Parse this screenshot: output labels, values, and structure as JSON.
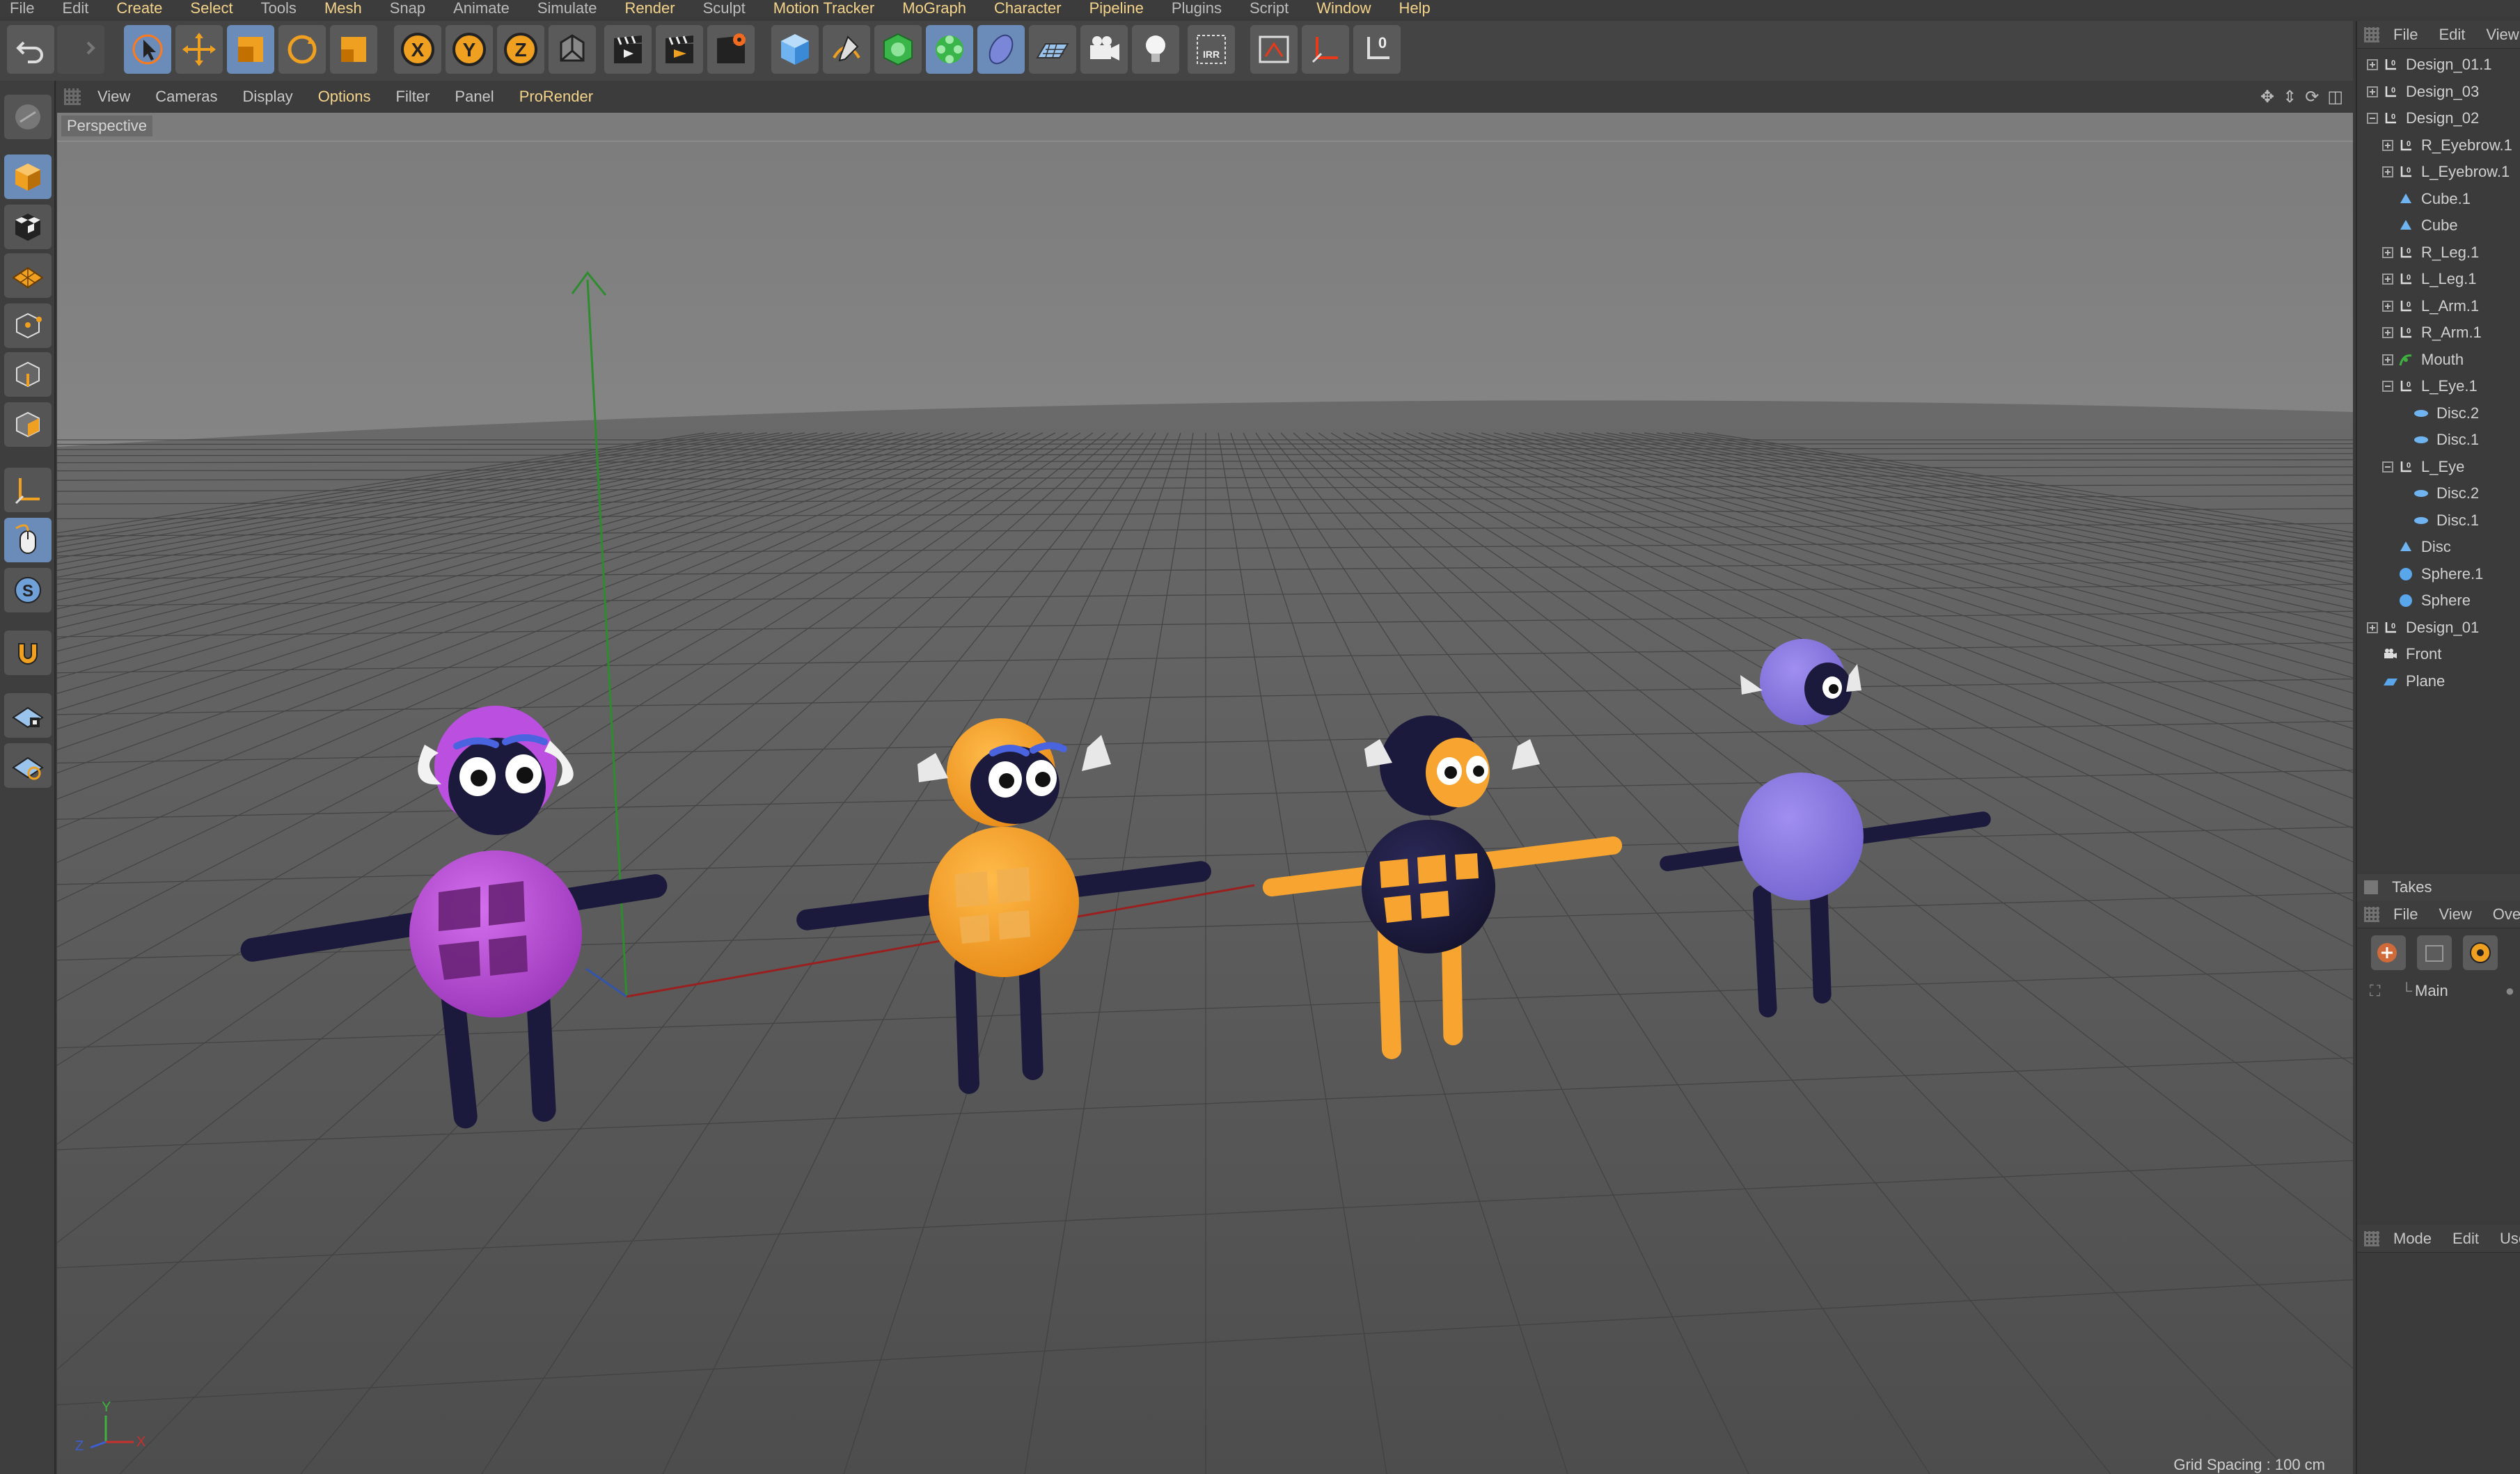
{
  "menubar": {
    "items": [
      {
        "label": "File",
        "highlight": false
      },
      {
        "label": "Edit",
        "highlight": false
      },
      {
        "label": "Create",
        "highlight": true
      },
      {
        "label": "Select",
        "highlight": true
      },
      {
        "label": "Tools",
        "highlight": false
      },
      {
        "label": "Mesh",
        "highlight": true
      },
      {
        "label": "Snap",
        "highlight": false
      },
      {
        "label": "Animate",
        "highlight": false
      },
      {
        "label": "Simulate",
        "highlight": false
      },
      {
        "label": "Render",
        "highlight": true
      },
      {
        "label": "Sculpt",
        "highlight": false
      },
      {
        "label": "Motion Tracker",
        "highlight": true
      },
      {
        "label": "MoGraph",
        "highlight": true
      },
      {
        "label": "Character",
        "highlight": true
      },
      {
        "label": "Pipeline",
        "highlight": true
      },
      {
        "label": "Plugins",
        "highlight": false
      },
      {
        "label": "Script",
        "highlight": false
      },
      {
        "label": "Window",
        "highlight": true
      },
      {
        "label": "Help",
        "highlight": true
      }
    ]
  },
  "toolbar": {
    "axis_x": "X",
    "axis_y": "Y",
    "axis_z": "Z",
    "irr_label": "IRR",
    "coord_label": "0"
  },
  "viewport": {
    "menu": [
      {
        "label": "View",
        "highlight": false
      },
      {
        "label": "Cameras",
        "highlight": false
      },
      {
        "label": "Display",
        "highlight": false
      },
      {
        "label": "Options",
        "highlight": true
      },
      {
        "label": "Filter",
        "highlight": false
      },
      {
        "label": "Panel",
        "highlight": false
      },
      {
        "label": "ProRender",
        "highlight": true
      }
    ],
    "camera_label": "Perspective",
    "grid_spacing": "Grid Spacing : 100 cm",
    "axis_labels": {
      "y": "Y",
      "z": "Z",
      "x": "X"
    }
  },
  "objects_panel": {
    "menu": [
      "File",
      "Edit",
      "View"
    ],
    "items": [
      {
        "name": "Design_01.1",
        "icon": "null-icon",
        "level": 0,
        "expander": "plus"
      },
      {
        "name": "Design_03",
        "icon": "null-icon",
        "level": 0,
        "expander": "plus"
      },
      {
        "name": "Design_02",
        "icon": "null-icon",
        "level": 0,
        "expander": "minus"
      },
      {
        "name": "R_Eyebrow.1",
        "icon": "null-icon",
        "level": 1,
        "expander": "plus"
      },
      {
        "name": "L_Eyebrow.1",
        "icon": "null-icon",
        "level": 1,
        "expander": "plus"
      },
      {
        "name": "Cube.1",
        "icon": "polygon-icon",
        "level": 1,
        "expander": "none"
      },
      {
        "name": "Cube",
        "icon": "polygon-icon",
        "level": 1,
        "expander": "none"
      },
      {
        "name": "R_Leg.1",
        "icon": "null-icon",
        "level": 1,
        "expander": "plus"
      },
      {
        "name": "L_Leg.1",
        "icon": "null-icon",
        "level": 1,
        "expander": "plus"
      },
      {
        "name": "L_Arm.1",
        "icon": "null-icon",
        "level": 1,
        "expander": "plus"
      },
      {
        "name": "R_Arm.1",
        "icon": "null-icon",
        "level": 1,
        "expander": "plus"
      },
      {
        "name": "Mouth",
        "icon": "spline-icon",
        "level": 1,
        "expander": "plus"
      },
      {
        "name": "L_Eye.1",
        "icon": "null-icon",
        "level": 1,
        "expander": "minus"
      },
      {
        "name": "Disc.2",
        "icon": "disc-icon",
        "level": 2,
        "expander": "none"
      },
      {
        "name": "Disc.1",
        "icon": "disc-icon",
        "level": 2,
        "expander": "none"
      },
      {
        "name": "L_Eye",
        "icon": "null-icon",
        "level": 1,
        "expander": "minus"
      },
      {
        "name": "Disc.2",
        "icon": "disc-icon",
        "level": 2,
        "expander": "none"
      },
      {
        "name": "Disc.1",
        "icon": "disc-icon",
        "level": 2,
        "expander": "none"
      },
      {
        "name": "Disc",
        "icon": "polygon-icon",
        "level": 1,
        "expander": "none"
      },
      {
        "name": "Sphere.1",
        "icon": "sphere-icon",
        "level": 1,
        "expander": "none"
      },
      {
        "name": "Sphere",
        "icon": "sphere-icon",
        "level": 1,
        "expander": "none"
      },
      {
        "name": "Design_01",
        "icon": "null-icon",
        "level": 0,
        "expander": "plus"
      },
      {
        "name": "Front",
        "icon": "camera-icon",
        "level": 0,
        "expander": "none"
      },
      {
        "name": "Plane",
        "icon": "plane-icon",
        "level": 0,
        "expander": "none"
      }
    ]
  },
  "takes_panel": {
    "title": "Takes",
    "menu": [
      "File",
      "View",
      "Overrides"
    ],
    "main_take": "Main"
  },
  "attributes_panel": {
    "menu": [
      "Mode",
      "Edit",
      "User Data"
    ]
  },
  "colors": {
    "accent_yellow": "#f4d38a",
    "selection_blue": "#6b8bb8",
    "purple_character": "#b84fd6",
    "orange_character": "#f7a530",
    "navy": "#1b1a3c",
    "lavender_character": "#8b79e0"
  }
}
